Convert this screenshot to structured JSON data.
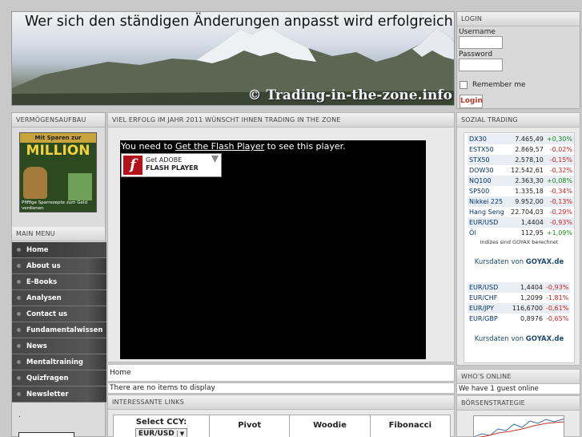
{
  "header": {
    "slogan": "Wer sich den ständigen Änderungen anpasst wird erfolgreich",
    "watermark": "© Trading-in-the-zone.info"
  },
  "login": {
    "title": "LOGIN",
    "username_label": "Username",
    "password_label": "Password",
    "remember_label": "Remember me",
    "button_label": "Login"
  },
  "left": {
    "vermoegen_title": "VERMÖGENSAUFBAU",
    "book_text_top": "Mit Sparen zur",
    "book_text_main": "MILLION",
    "book_text_sub": "Pfiffige Sparrezepte zum Geld verdienen",
    "main_menu_title": "MAIN MENU",
    "menu": [
      {
        "label": "Home"
      },
      {
        "label": "About us"
      },
      {
        "label": "E-Books"
      },
      {
        "label": "Analysen"
      },
      {
        "label": "Contact us"
      },
      {
        "label": "Fundamentalwissen"
      },
      {
        "label": "News"
      },
      {
        "label": "Mentaltraining"
      },
      {
        "label": "Quizfragen"
      },
      {
        "label": "Newsletter"
      }
    ],
    "bottom_mark": "."
  },
  "center": {
    "title": "VIEL ERFOLG IM JAHR 2011 WÜNSCHT IHNEN TRADING IN THE ZONE",
    "flash_prefix": "You need to ",
    "flash_link": "Get the Flash Player",
    "flash_suffix": " to see this player.",
    "get_flash_line1": "Get ADOBE",
    "get_flash_line2": "FLASH PLAYER",
    "breadcrumb": "Home",
    "no_items": "There are no items to display",
    "links_title": "INTERESSANTE LINKS",
    "pivot": {
      "select_label": "Select CCY:",
      "select_value": "EUR/USD",
      "columns": [
        "Pivot",
        "Woodie",
        "Fibonacci"
      ]
    }
  },
  "right": {
    "sozial_title": "SOZIAL TRADING",
    "quotes": [
      {
        "name": "DX30",
        "value": "7.465,49",
        "change": "+0,30%",
        "dir": "up"
      },
      {
        "name": "ESTX50",
        "value": "2.869,57",
        "change": "-0,02%",
        "dir": "dn"
      },
      {
        "name": "STX50",
        "value": "2.578,10",
        "change": "-0,15%",
        "dir": "dn"
      },
      {
        "name": "DOW30",
        "value": "12.542,61",
        "change": "-0,32%",
        "dir": "dn"
      },
      {
        "name": "NQ100",
        "value": "2.363,30",
        "change": "+0,08%",
        "dir": "up"
      },
      {
        "name": "SP500",
        "value": "1.335,18",
        "change": "-0,34%",
        "dir": "dn"
      },
      {
        "name": "Nikkei 225",
        "value": "9.952,00",
        "change": "-0,13%",
        "dir": "dn"
      },
      {
        "name": "Hang Seng",
        "value": "22.704,03",
        "change": "-0,29%",
        "dir": "dn"
      },
      {
        "name": "EUR/USD",
        "value": "1,4404",
        "change": "-0,93%",
        "dir": "dn"
      },
      {
        "name": "Öl",
        "value": "112,95",
        "change": "+1,09%",
        "dir": "up"
      }
    ],
    "quotes_note": "Indizes sind GOYAX berechnet",
    "kursdaten_prefix": "Kursdaten von ",
    "kursdaten_brand": "GOYAX.de",
    "fx": [
      {
        "name": "EUR/USD",
        "value": "1,4404",
        "change": "-0,93%"
      },
      {
        "name": "EUR/CHF",
        "value": "1,2099",
        "change": "-1,81%"
      },
      {
        "name": "EUR/JPY",
        "value": "116,6700",
        "change": "-0,61%"
      },
      {
        "name": "EUR/GBP",
        "value": "0,8976",
        "change": "-0,65%"
      }
    ],
    "whos_online_title": "WHO'S ONLINE",
    "whos_online_text": "We have 1 guest online",
    "boersen_title": "BÖRSENSTRATEGIE"
  },
  "colors": {
    "up": "#1a8a1a",
    "down": "#d02020",
    "login_button": "#c0392b",
    "goyax": "#1d4a6e"
  }
}
